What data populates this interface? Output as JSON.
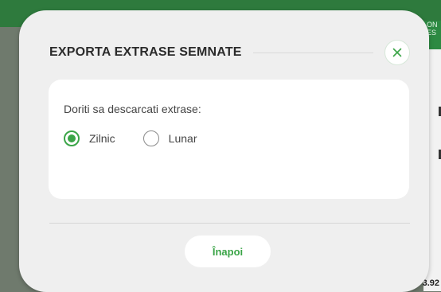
{
  "background": {
    "right_tag_line1": "ON",
    "right_tag_line2": "ES",
    "bottom_value": "3.92"
  },
  "modal": {
    "title": "EXPORTA EXTRASE SEMNATE",
    "close_icon": "close-icon",
    "question": "Doriti sa descarcati extrase:",
    "options": [
      {
        "label": "Zilnic",
        "selected": true
      },
      {
        "label": "Lunar",
        "selected": false
      }
    ],
    "back_button": "Înapoi"
  },
  "colors": {
    "accent": "#3ba548",
    "title": "#2b2b2b",
    "modal_bg": "#efefef"
  }
}
